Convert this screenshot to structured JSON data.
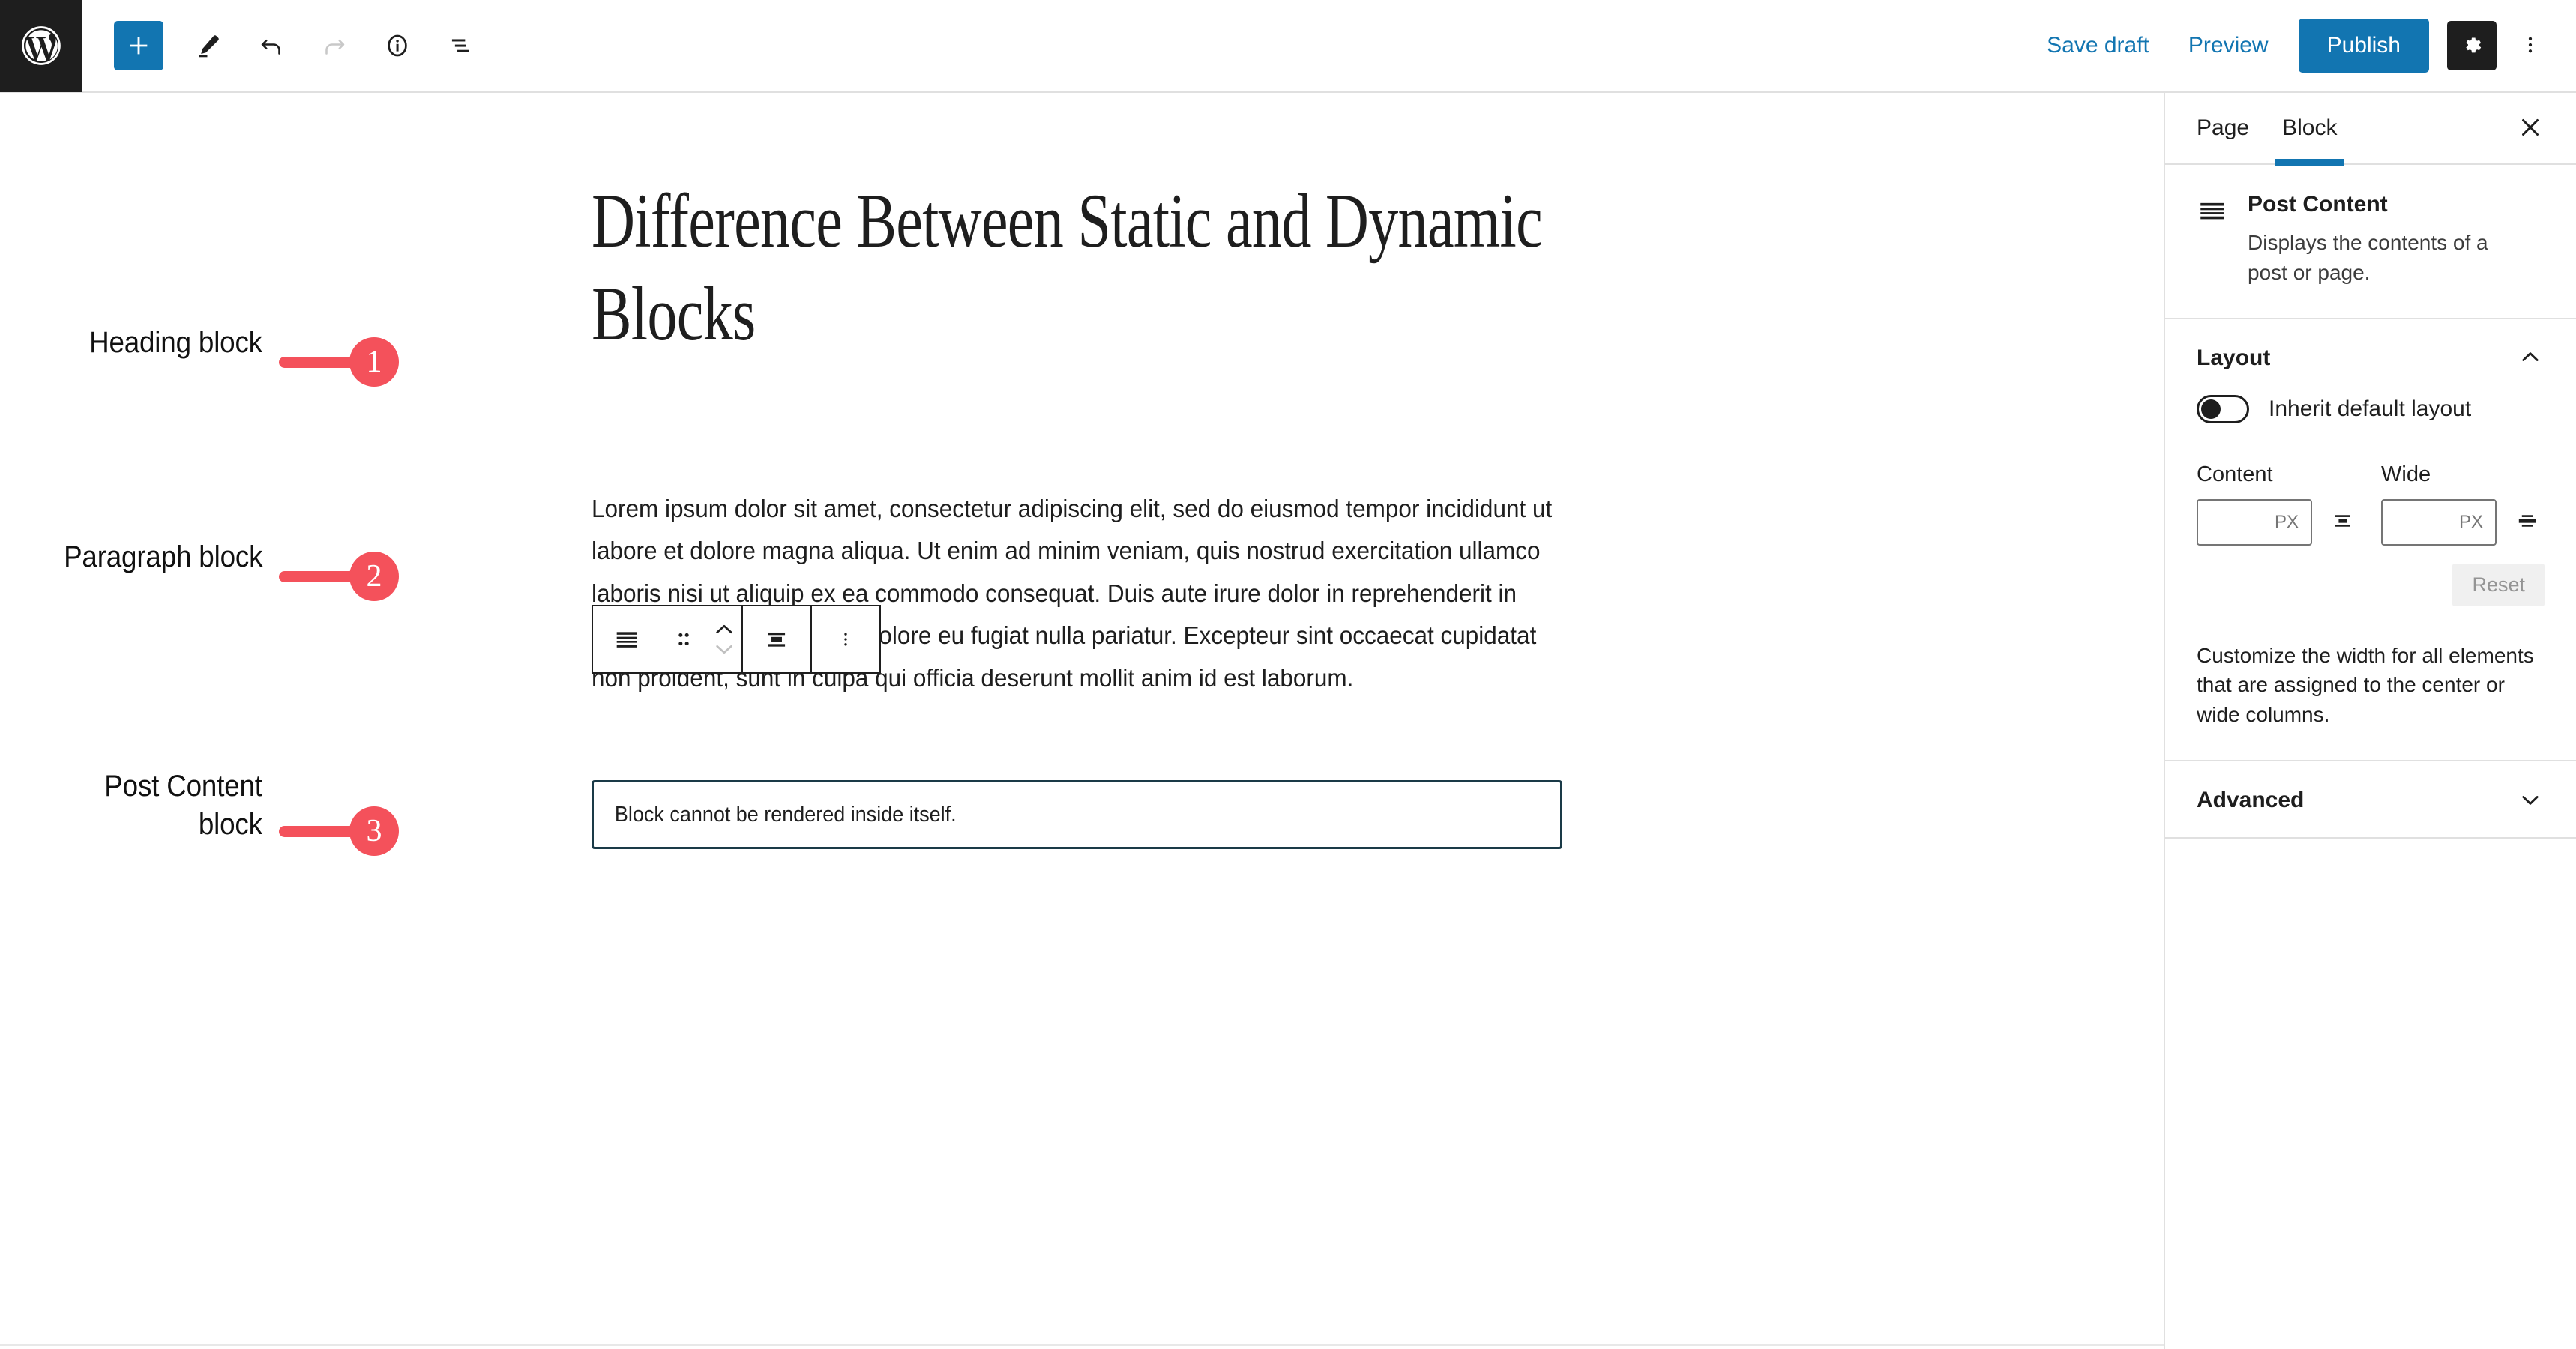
{
  "topbar": {
    "logo_label": "WordPress",
    "add_block_label": "Add block",
    "tools_label": "Tools",
    "undo_label": "Undo",
    "redo_label": "Redo",
    "details_label": "Details",
    "list_view_label": "List View",
    "save_draft_label": "Save draft",
    "preview_label": "Preview",
    "publish_label": "Publish",
    "settings_label": "Settings",
    "options_label": "Options",
    "accent_blue": "#1275b1",
    "dark": "#1e1e1e"
  },
  "editor": {
    "heading": "Difference Between Static and Dynamic Blocks",
    "paragraph": "Lorem ipsum dolor sit amet, consectetur adipiscing elit, sed do eiusmod tempor incididunt ut labore et dolore magna aliqua. Ut enim ad minim veniam, quis nostrud exercitation ullamco laboris nisi ut aliquip ex ea commodo consequat. Duis aute irure dolor in reprehenderit in voluptate velit esse cillum dolore eu fugiat nulla pariatur. Excepteur sint occaecat cupidatat non proident, sunt in culpa qui officia deserunt mollit anim id est laborum.",
    "post_content_notice": "Block cannot be rendered inside itself.",
    "notice_border_color": "#1a3a47"
  },
  "block_toolbar": {
    "block_type_label": "Post Content",
    "drag_label": "Drag",
    "move_up_label": "Move up",
    "move_down_label": "Move down",
    "align_label": "Align",
    "options_label": "Options"
  },
  "annotations": [
    {
      "id": 1,
      "label": "Heading block",
      "number": "1"
    },
    {
      "id": 2,
      "label": "Paragraph block",
      "number": "2"
    },
    {
      "id": 3,
      "label": "Post Content\nblock",
      "number": "3"
    }
  ],
  "annotation_color": "#f4515b",
  "sidebar": {
    "tabs": [
      {
        "label": "Page",
        "active": false
      },
      {
        "label": "Block",
        "active": true
      }
    ],
    "close_label": "Close Settings",
    "block_card": {
      "title": "Post Content",
      "description": "Displays the contents of a post or page.",
      "icon": "post-content-icon"
    },
    "layout_panel": {
      "title": "Layout",
      "expanded": true,
      "inherit_toggle_label": "Inherit default layout",
      "inherit_toggle_on": false,
      "content_label": "Content",
      "content_value": "",
      "content_unit": "PX",
      "wide_label": "Wide",
      "wide_value": "",
      "wide_unit": "PX",
      "reset_label": "Reset",
      "help_text": "Customize the width for all elements that are assigned to the center or wide columns."
    },
    "advanced_panel": {
      "title": "Advanced",
      "expanded": false
    }
  }
}
